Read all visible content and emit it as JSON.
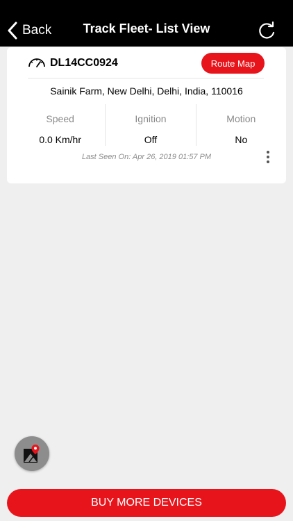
{
  "navbar": {
    "back_label": "Back",
    "title": "Track Fleet- List View",
    "refresh_icon": "refresh-icon"
  },
  "vehicle": {
    "icon": "speedometer-icon",
    "number": "DL14CC0924",
    "route_button_label": "Route Map",
    "address": "Sainik Farm, New Delhi, Delhi, India, 110016",
    "stats": [
      {
        "label": "Speed",
        "value": "0.0 Km/hr"
      },
      {
        "label": "Ignition",
        "value": "Off"
      },
      {
        "label": "Motion",
        "value": "No"
      }
    ],
    "last_seen": "Last Seen On: Apr 26, 2019 01:57 PM",
    "more_icon": "more-vertical-icon"
  },
  "fab": {
    "icon": "map-pin-icon"
  },
  "footer": {
    "buy_label": "BUY MORE DEVICES"
  },
  "colors": {
    "accent": "#e8141b",
    "navbar": "#000000",
    "background": "#efeff0"
  }
}
